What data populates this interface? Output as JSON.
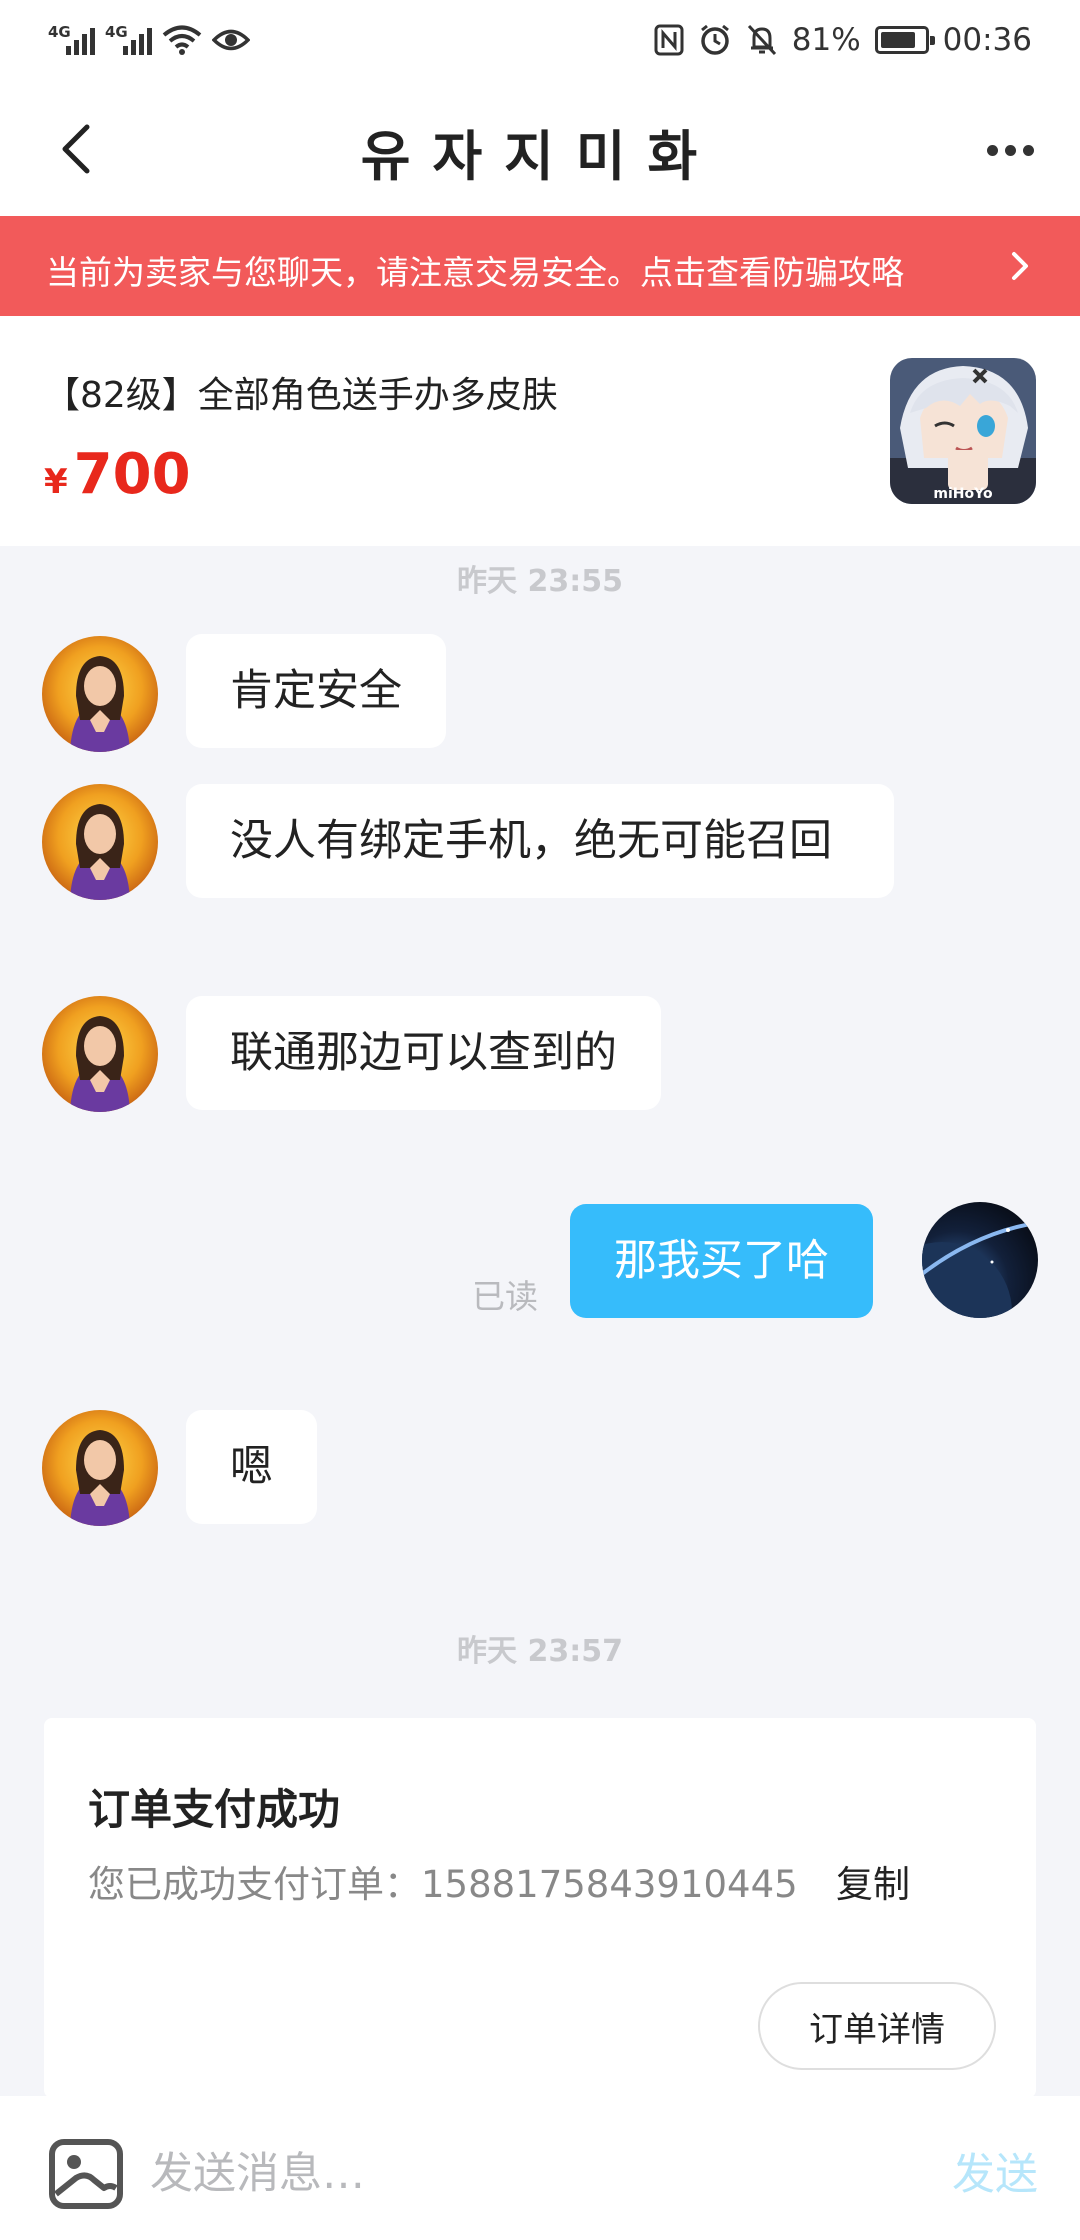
{
  "status_bar": {
    "net1": "4G",
    "net2": "4G",
    "battery_text": "81%",
    "battery_level": 0.81,
    "time": "00:36"
  },
  "nav": {
    "title": "유자지미화",
    "back_icon": "chevron-left-icon",
    "more_icon": "more-horizontal-icon"
  },
  "banner": {
    "text": "当前为卖家与您聊天，请注意交易安全。点击查看防骗攻略",
    "color": "#f25a5a"
  },
  "product": {
    "title": "【82级】全部角色送手办多皮肤",
    "currency": "¥",
    "price": "700",
    "thumb_label": "miHoYo"
  },
  "chat": {
    "timestamp1": "昨天 23:55",
    "msg1": "肯定安全",
    "msg2": "没人有绑定手机，绝无可能召回",
    "msg3": "联通那边可以查到的",
    "read_label": "已读",
    "my_msg": "那我买了哈",
    "msg4": "嗯",
    "timestamp2": "昨天 23:57"
  },
  "order": {
    "title": "订单支付成功",
    "line": "您已成功支付订单：1588175843910445",
    "copy": "复制",
    "details_button": "订单详情"
  },
  "input_bar": {
    "placeholder": "发送消息…",
    "send": "发送",
    "image_icon": "image-icon"
  },
  "colors": {
    "accent": "#36bcfb",
    "price": "#e8281c",
    "send_disabled": "#b6e6fb"
  }
}
